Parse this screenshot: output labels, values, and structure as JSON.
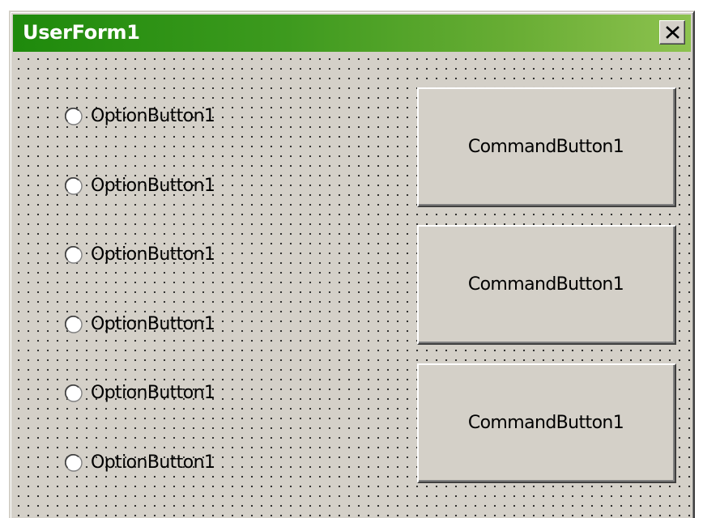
{
  "window": {
    "title": "UserForm1",
    "title_gradient": [
      "#1e8a0c",
      "#8dc24f"
    ],
    "face_color": "#d4d0c8"
  },
  "option_buttons": [
    {
      "label": "OptionButton1",
      "checked": false
    },
    {
      "label": "OptionButton1",
      "checked": false
    },
    {
      "label": "OptionButton1",
      "checked": false
    },
    {
      "label": "OptionButton1",
      "checked": false
    },
    {
      "label": "OptionButton1",
      "checked": false
    },
    {
      "label": "OptionButton1",
      "checked": false
    }
  ],
  "command_buttons": [
    {
      "label": "CommandButton1"
    },
    {
      "label": "CommandButton1"
    },
    {
      "label": "CommandButton1"
    }
  ],
  "icons": {
    "close": "close-icon",
    "radio": "radio-unchecked-icon"
  }
}
